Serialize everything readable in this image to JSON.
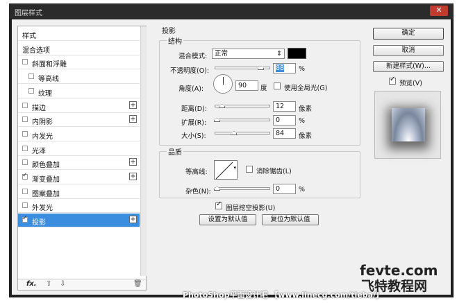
{
  "window": {
    "title": "图层样式",
    "close": "✕"
  },
  "left": {
    "items": [
      {
        "label": "样式",
        "checkbox": false,
        "checked": false,
        "plus": false,
        "indent": 0
      },
      {
        "label": "混合选项",
        "checkbox": false,
        "checked": false,
        "plus": false,
        "indent": 0
      },
      {
        "label": "斜面和浮雕",
        "checkbox": true,
        "checked": false,
        "plus": false,
        "indent": 0
      },
      {
        "label": "等高线",
        "checkbox": true,
        "checked": false,
        "plus": false,
        "indent": 1
      },
      {
        "label": "纹理",
        "checkbox": true,
        "checked": false,
        "plus": false,
        "indent": 1
      },
      {
        "label": "描边",
        "checkbox": true,
        "checked": false,
        "plus": true,
        "indent": 0
      },
      {
        "label": "内阴影",
        "checkbox": true,
        "checked": false,
        "plus": true,
        "indent": 0
      },
      {
        "label": "内发光",
        "checkbox": true,
        "checked": false,
        "plus": false,
        "indent": 0
      },
      {
        "label": "光泽",
        "checkbox": true,
        "checked": false,
        "plus": false,
        "indent": 0
      },
      {
        "label": "颜色叠加",
        "checkbox": true,
        "checked": false,
        "plus": true,
        "indent": 0
      },
      {
        "label": "渐变叠加",
        "checkbox": true,
        "checked": true,
        "plus": true,
        "indent": 0
      },
      {
        "label": "图案叠加",
        "checkbox": true,
        "checked": false,
        "plus": false,
        "indent": 0
      },
      {
        "label": "外发光",
        "checkbox": true,
        "checked": false,
        "plus": false,
        "indent": 0
      },
      {
        "label": "投影",
        "checkbox": true,
        "checked": true,
        "plus": true,
        "indent": 0,
        "selected": true
      }
    ],
    "footer": {
      "fx": "fx.",
      "up": "⇧",
      "down": "⇩",
      "trash": "🗑"
    }
  },
  "shadow": {
    "group_title": "投影",
    "structure_title": "结构",
    "blend_mode_label": "混合模式:",
    "blend_mode_value": "正常",
    "shadow_color": "#000000",
    "opacity_label": "不透明度(O):",
    "opacity_value": "88",
    "opacity_unit": "%",
    "opacity_fraction": 0.88,
    "angle_label": "角度(A):",
    "angle_value": "90",
    "angle_unit": "度",
    "global_light_label": "使用全局光(G)",
    "global_light_checked": false,
    "distance_label": "距离(D):",
    "distance_value": "12",
    "distance_unit": "像素",
    "distance_fraction": 0.1,
    "spread_label": "扩展(R):",
    "spread_value": "0",
    "spread_unit": "%",
    "spread_fraction": 0.0,
    "size_label": "大小(S):",
    "size_value": "84",
    "size_unit": "像素",
    "size_fraction": 0.34,
    "quality_title": "品质",
    "contour_label": "等高线:",
    "antialias_label": "消除锯齿(L)",
    "antialias_checked": false,
    "noise_label": "杂色(N):",
    "noise_value": "0",
    "noise_unit": "%",
    "noise_fraction": 0.0,
    "knockout_label": "图层挖空投影(U)",
    "knockout_checked": true,
    "make_default": "设置为默认值",
    "reset_default": "复位为默认值"
  },
  "buttons": {
    "ok": "确定",
    "cancel": "取消",
    "new_style": "新建样式(W)...",
    "preview_label": "预览(V)",
    "preview_checked": true
  },
  "overlay": {
    "watermark": "PhotoShop平面设计吧 【www.linecg.com/tieba/】",
    "logo_line1": "fevte.com",
    "logo_line2": "飞特教程网"
  }
}
